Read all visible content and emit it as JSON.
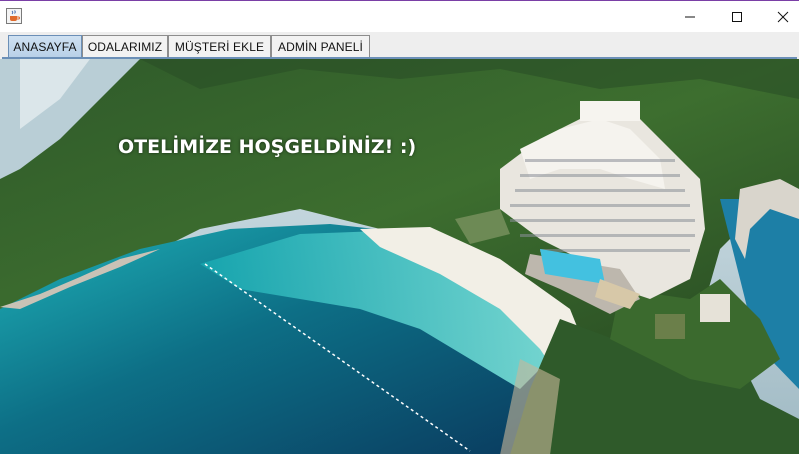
{
  "window": {
    "app_icon": "java-cup-icon",
    "controls": [
      "minimize-icon",
      "maximize-icon",
      "close-icon"
    ]
  },
  "tabs": [
    {
      "label": "ANASAYFA",
      "selected": true
    },
    {
      "label": "ODALARIMIZ",
      "selected": false
    },
    {
      "label": "MÜŞTERİ EKLE",
      "selected": false
    },
    {
      "label": "ADMİN PANELİ",
      "selected": false
    }
  ],
  "home": {
    "welcome_text": "OTELİMİZE HOŞGELDİNİZ!  :)"
  },
  "colors": {
    "selected_tab": "#b8d0e8",
    "tab_border": "#8d8d8d",
    "welcome_text": "#ffffff"
  }
}
